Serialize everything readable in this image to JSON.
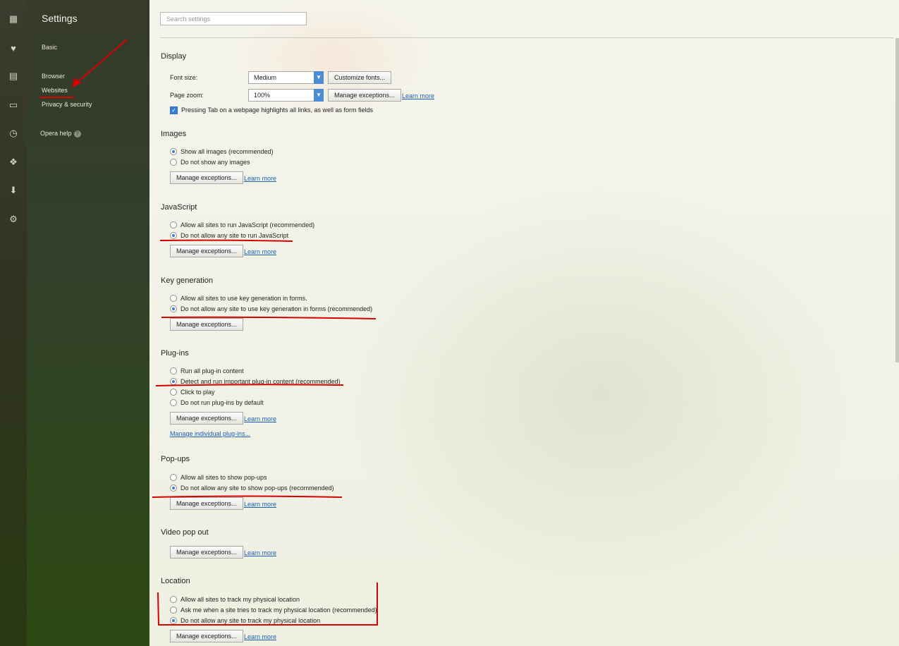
{
  "nav": {
    "title": "Settings",
    "items": {
      "basic": "Basic",
      "browser": "Browser",
      "websites": "Websites",
      "privacy": "Privacy & security",
      "help": "Opera help",
      "help_badge": "?"
    }
  },
  "iconbar": [
    "speed-dial-icon",
    "heart-icon",
    "news-icon",
    "devices-icon",
    "history-icon",
    "extensions-icon",
    "downloads-icon",
    "settings-icon"
  ],
  "search": {
    "placeholder": "Search settings"
  },
  "display": {
    "title": "Display",
    "font_size_label": "Font size:",
    "font_size_value": "Medium",
    "customize_fonts": "Customize fonts...",
    "page_zoom_label": "Page zoom:",
    "page_zoom_value": "100%",
    "manage_exceptions": "Manage exceptions...",
    "learn_more": "Learn more",
    "tab_highlight": "Pressing Tab on a webpage highlights all links, as well as form fields",
    "tab_highlight_checked": true
  },
  "images": {
    "title": "Images",
    "opt1": "Show all images (recommended)",
    "opt2": "Do not show any images",
    "selected": 1,
    "manage_exceptions": "Manage exceptions...",
    "learn_more": "Learn more"
  },
  "javascript": {
    "title": "JavaScript",
    "opt1": "Allow all sites to run JavaScript (recommended)",
    "opt2": "Do not allow any site to run JavaScript",
    "selected": 2,
    "manage_exceptions": "Manage exceptions...",
    "learn_more": "Learn more"
  },
  "keygen": {
    "title": "Key generation",
    "opt1": "Allow all sites to use key generation in forms.",
    "opt2": "Do not allow any site to use key generation in forms (recommended)",
    "selected": 2,
    "manage_exceptions": "Manage exceptions..."
  },
  "plugins": {
    "title": "Plug-ins",
    "opt1": "Run all plug-in content",
    "opt2": "Detect and run important plug-in content (recommended)",
    "opt3": "Click to play",
    "opt4": "Do not run plug-ins by default",
    "selected": 2,
    "manage_exceptions": "Manage exceptions...",
    "learn_more": "Learn more",
    "manage_individual": "Manage individual plug-ins..."
  },
  "popups": {
    "title": "Pop-ups",
    "opt1": "Allow all sites to show pop-ups",
    "opt2": "Do not allow any site to show pop-ups (recommended)",
    "selected": 2,
    "manage_exceptions": "Manage exceptions...",
    "learn_more": "Learn more"
  },
  "video_popout": {
    "title": "Video pop out",
    "manage_exceptions": "Manage exceptions...",
    "learn_more": "Learn more"
  },
  "location": {
    "title": "Location",
    "opt1": "Allow all sites to track my physical location",
    "opt2": "Ask me when a site tries to track my physical location (recommended)",
    "opt3": "Do not allow any site to track my physical location",
    "selected": 3,
    "manage_exceptions": "Manage exceptions...",
    "learn_more": "Learn more"
  },
  "colors": {
    "annotation_red": "#d60000",
    "accent_blue": "#3a7fd0"
  }
}
